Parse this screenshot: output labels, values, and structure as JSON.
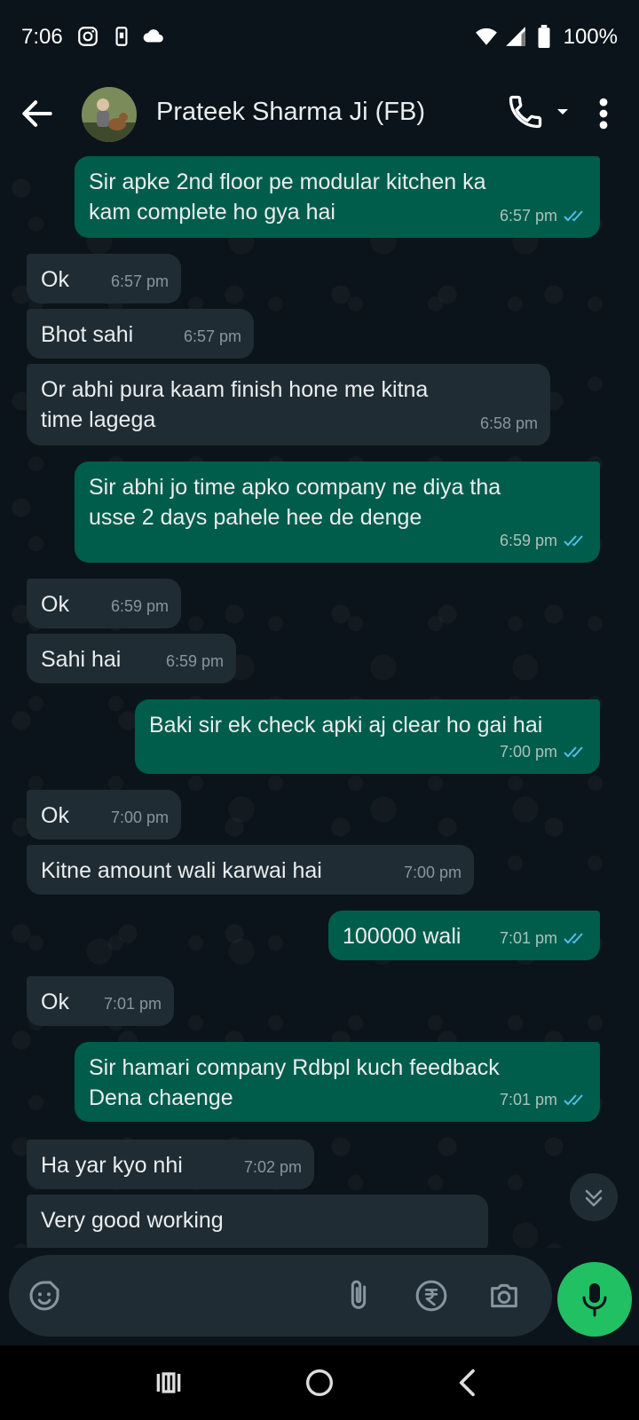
{
  "status_bar": {
    "time": "7:06",
    "battery": "100%"
  },
  "header": {
    "contact_name": "Prateek Sharma Ji (FB)"
  },
  "messages": [
    {
      "dir": "out",
      "text": "Sir apke 2nd floor pe modular kitchen ka\nkam complete ho gya hai",
      "time": "6:57 pm",
      "read": true
    },
    {
      "dir": "in",
      "text": "Ok",
      "time": "6:57 pm"
    },
    {
      "dir": "in",
      "text": "Bhot sahi",
      "time": "6:57 pm"
    },
    {
      "dir": "in",
      "text": "Or abhi pura kaam finish hone me kitna\ntime lagega",
      "time": "6:58 pm"
    },
    {
      "dir": "out",
      "text": "Sir abhi jo time apko company ne diya tha\nusse 2 days pahele hee de denge",
      "time": "6:59 pm",
      "read": true
    },
    {
      "dir": "in",
      "text": "Ok",
      "time": "6:59 pm"
    },
    {
      "dir": "in",
      "text": "Sahi hai",
      "time": "6:59 pm"
    },
    {
      "dir": "out",
      "text": "Baki sir ek check apki aj clear ho gai hai",
      "time": "7:00 pm",
      "read": true
    },
    {
      "dir": "in",
      "text": "Ok",
      "time": "7:00 pm"
    },
    {
      "dir": "in",
      "text": "Kitne amount wali karwai hai",
      "time": "7:00 pm"
    },
    {
      "dir": "out",
      "text": "100000 wali",
      "time": "7:01 pm",
      "read": true
    },
    {
      "dir": "in",
      "text": "Ok",
      "time": "7:01 pm"
    },
    {
      "dir": "out",
      "text": "Sir hamari company Rdbpl kuch feedback\nDena chaenge",
      "time": "7:01 pm",
      "read": true
    },
    {
      "dir": "in",
      "text": "Ha yar kyo nhi",
      "time": "7:02 pm"
    },
    {
      "dir": "in",
      "text": "Very good working",
      "time": ""
    }
  ],
  "colors": {
    "outgoing_bubble": "#005c4b",
    "incoming_bubble": "#202c33",
    "read_ticks": "#53bdeb",
    "mic_button": "#21c063"
  },
  "icons": {
    "status": [
      "instagram-icon",
      "phone-sync-icon",
      "cloud-icon",
      "wifi-icon",
      "signal-icon",
      "battery-icon"
    ],
    "input": [
      "sticker-icon",
      "attach-icon",
      "rupee-payment-icon",
      "camera-icon",
      "mic-icon"
    ]
  }
}
